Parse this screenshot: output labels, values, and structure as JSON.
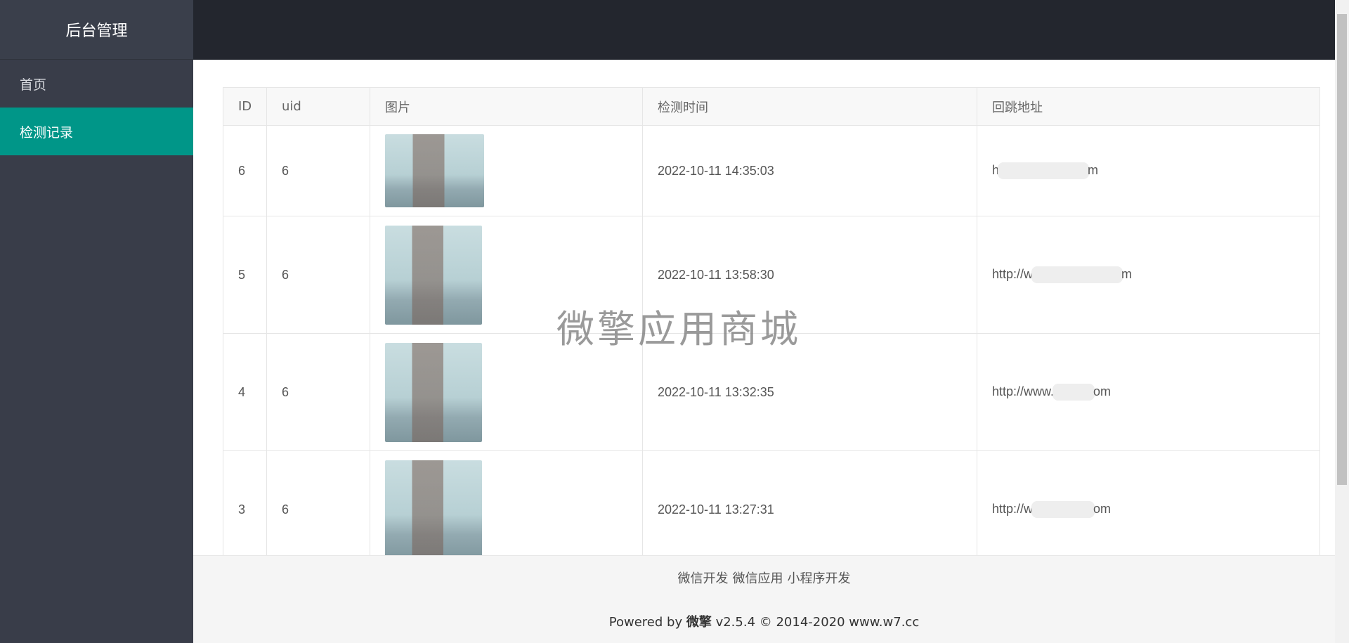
{
  "sidebar": {
    "logo": "后台管理",
    "items": [
      {
        "label": "首页"
      },
      {
        "label": "检测记录"
      }
    ]
  },
  "table": {
    "headers": [
      "ID",
      "uid",
      "图片",
      "检测时间",
      "回跳地址"
    ],
    "rows": [
      {
        "id": "6",
        "uid": "6",
        "time": "2022-10-11 14:35:03",
        "url_prefix": "h",
        "url_suffix": "m"
      },
      {
        "id": "5",
        "uid": "6",
        "time": "2022-10-11 13:58:30",
        "url_prefix": "http://w",
        "url_suffix": "m"
      },
      {
        "id": "4",
        "uid": "6",
        "time": "2022-10-11 13:32:35",
        "url_prefix": "http://www.",
        "url_suffix": "om"
      },
      {
        "id": "3",
        "uid": "6",
        "time": "2022-10-11 13:27:31",
        "url_prefix": "http://w",
        "url_suffix": "om"
      }
    ]
  },
  "watermark": "微擎应用商城",
  "footer": {
    "links": [
      "微信开发",
      "微信应用",
      "小程序开发"
    ],
    "copy_prefix": "Powered by ",
    "brand": "微擎",
    "copy_suffix": " v2.5.4 © 2014-2020 www.w7.cc"
  },
  "colors": {
    "sidebar": "#393d49",
    "active": "#009688",
    "header": "#23262e"
  }
}
